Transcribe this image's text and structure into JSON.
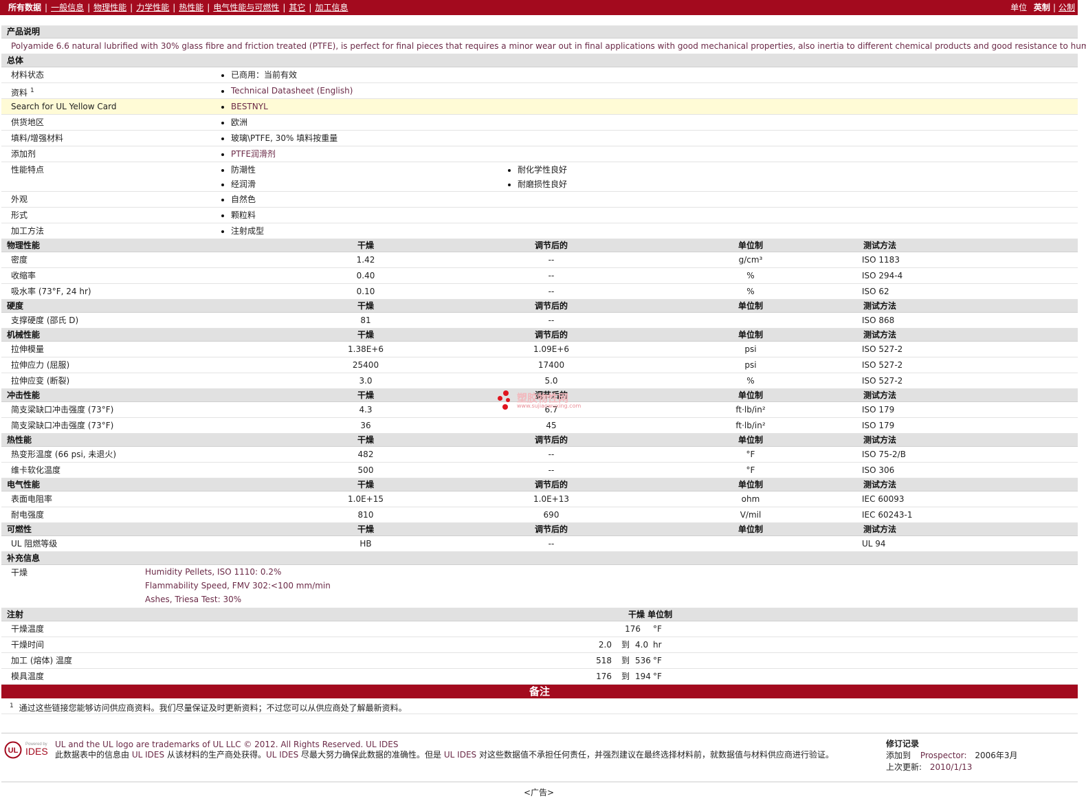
{
  "topbar": {
    "all_data": "所有数据",
    "tabs": [
      "一般信息",
      "物理性能",
      "力学性能",
      "热性能",
      "电气性能与可燃性",
      "其它",
      "加工信息"
    ],
    "units_label": "单位",
    "unit_english": "英制",
    "unit_metric": "公制"
  },
  "product_desc": {
    "title": "产品说明",
    "text": "Polyamide 6.6 natural lubrified with 30% glass fibre and friction treated (PTFE), is perfect for final pieces that requires a minor wear out in final applications with good mechanical properties, also inertia to different chemical products and good resistance to humidity."
  },
  "general": {
    "title": "总体",
    "rows": [
      {
        "label": "材料状态",
        "values": [
          "已商用：当前有效"
        ]
      },
      {
        "label": "资料",
        "sup": "1",
        "values": [
          "Technical Datasheet (English)"
        ]
      },
      {
        "label": "Search for UL Yellow Card",
        "values": [
          "BESTNYL"
        ]
      },
      {
        "label": "供货地区",
        "values": [
          "欧洲"
        ]
      },
      {
        "label": "填料/增强材料",
        "values": [
          "玻璃\\PTFE, 30% 填料按重量"
        ]
      },
      {
        "label": "添加剂",
        "values": [
          "PTFE润滑剂"
        ]
      },
      {
        "label": "性能特点",
        "col1": [
          "防潮性",
          "经润滑"
        ],
        "col2": [
          "耐化学性良好",
          "耐磨损性良好"
        ]
      },
      {
        "label": "外观",
        "values": [
          "自然色"
        ]
      },
      {
        "label": "形式",
        "values": [
          "颗粒料"
        ]
      },
      {
        "label": "加工方法",
        "values": [
          "注射成型"
        ]
      }
    ]
  },
  "col_headers": {
    "dry": "干燥",
    "cond": "调节后的",
    "unit": "单位制",
    "method": "测试方法"
  },
  "sections": [
    {
      "title": "物理性能",
      "rows": [
        {
          "label": "密度",
          "dry": "1.42",
          "cond": "--",
          "unit": "g/cm³",
          "method": "ISO 1183"
        },
        {
          "label": "收缩率",
          "dry": "0.40",
          "cond": "--",
          "unit": "%",
          "method": "ISO 294-4"
        },
        {
          "label": "吸水率 (73°F, 24 hr)",
          "dry": "0.10",
          "cond": "--",
          "unit": "%",
          "method": "ISO 62"
        }
      ]
    },
    {
      "title": "硬度",
      "rows": [
        {
          "label": "支撑硬度 (邵氏 D)",
          "dry": "81",
          "cond": "--",
          "unit": "",
          "method": "ISO 868"
        }
      ]
    },
    {
      "title": "机械性能",
      "rows": [
        {
          "label": "拉伸模量",
          "dry": "1.38E+6",
          "cond": "1.09E+6",
          "unit": "psi",
          "method": "ISO 527-2"
        },
        {
          "label": "拉伸应力 (屈服)",
          "dry": "25400",
          "cond": "17400",
          "unit": "psi",
          "method": "ISO 527-2"
        },
        {
          "label": "拉伸应变 (断裂)",
          "dry": "3.0",
          "cond": "5.0",
          "unit": "%",
          "method": "ISO 527-2"
        }
      ]
    },
    {
      "title": "冲击性能",
      "rows": [
        {
          "label": "简支梁缺口冲击强度 (73°F)",
          "dry": "4.3",
          "cond": "6.7",
          "unit": "ft·lb/in²",
          "method": "ISO 179"
        },
        {
          "label": "简支梁缺口冲击强度 (73°F)",
          "dry": "36",
          "cond": "45",
          "unit": "ft·lb/in²",
          "method": "ISO 179"
        }
      ]
    },
    {
      "title": "热性能",
      "rows": [
        {
          "label": "热变形温度 (66 psi, 未退火)",
          "dry": "482",
          "cond": "--",
          "unit": "°F",
          "method": "ISO 75-2/B"
        },
        {
          "label": "维卡软化温度",
          "dry": "500",
          "cond": "--",
          "unit": "°F",
          "method": "ISO 306"
        }
      ]
    },
    {
      "title": "电气性能",
      "rows": [
        {
          "label": "表面电阻率",
          "dry": "1.0E+15",
          "cond": "1.0E+13",
          "unit": "ohm",
          "method": "IEC 60093"
        },
        {
          "label": "耐电强度",
          "dry": "810",
          "cond": "690",
          "unit": "V/mil",
          "method": "IEC 60243-1"
        }
      ]
    },
    {
      "title": "可燃性",
      "rows": [
        {
          "label": "UL 阻燃等级",
          "dry": "HB",
          "cond": "--",
          "unit": "",
          "method": "UL 94"
        }
      ]
    }
  ],
  "supplement": {
    "title": "补充信息",
    "label": "干燥",
    "lines": [
      "Humidity Pellets, ISO 1110: 0.2%",
      "Flammability Speed, FMV 302:<100 mm/min",
      "Ashes, Triesa Test: 30%"
    ]
  },
  "injection": {
    "title": "注射",
    "header": "干燥 单位制",
    "rows": [
      {
        "label": "干燥温度",
        "from": "176",
        "to_word": "",
        "to": "",
        "unit": "°F"
      },
      {
        "label": "干燥时间",
        "from": "2.0",
        "to_word": "到",
        "to": "4.0",
        "unit": "hr"
      },
      {
        "label": "加工 (熔体) 温度",
        "from": "518",
        "to_word": "到",
        "to": "536",
        "unit": "°F"
      },
      {
        "label": "模具温度",
        "from": "176",
        "to_word": "到",
        "to": "194",
        "unit": "°F"
      }
    ]
  },
  "notes": {
    "title": "备注",
    "sup": "1",
    "text": "通过这些链接您能够访问供应商资料。我们尽量保证及时更新资料；不过您可以从供应商处了解最新资料。"
  },
  "footer": {
    "logo_small": "Powered by",
    "logo_text": "IDES",
    "trademark": "UL and the UL logo are trademarks of UL LLC © 2012. All Rights Reserved. UL IDES",
    "disclaimer_a": "此数据表中的信息由",
    "ul_ides": "UL IDES",
    "disclaimer_b": "从该材料的生产商处获得。",
    "disclaimer_c": "尽最大努力确保此数据的准确性。但是",
    "disclaimer_d": "对这些数据值不承担任何责任，并强烈建议在最终选择材料前，就数据值与材料供应商进行验证。",
    "rev_title": "修订记录",
    "added_label": "添加到",
    "prospector": "Prospector:",
    "added_date": "2006年3月",
    "updated_label": "上次更新:",
    "updated_date": "2010/1/13"
  },
  "ad": "<广告>",
  "watermark": {
    "text": "塑胶物性网",
    "url": "www.sujiaowuxing.com"
  },
  "colors": {
    "brand": "#a30a1e",
    "link": "#6b2a47",
    "header_bg": "#e1e1e1",
    "highlight": "#fffbd6"
  }
}
